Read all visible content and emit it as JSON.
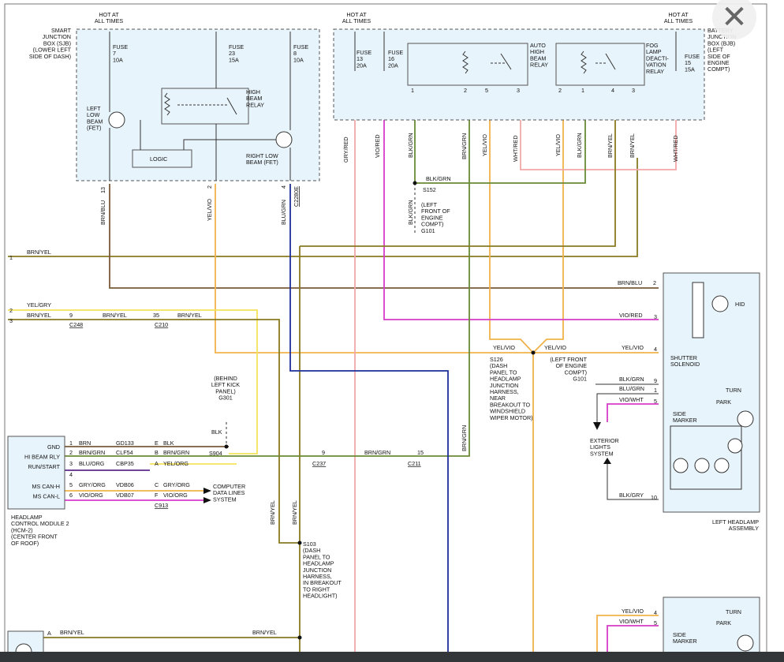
{
  "labels": {
    "hot_sjb": [
      "HOT AT",
      "ALL TIMES"
    ],
    "hot_center": [
      "HOT AT",
      "ALL TIMES"
    ],
    "hot_right": [
      "HOT AT",
      "ALL TIMES"
    ],
    "sjb": [
      "SMART",
      "JUNCTION",
      "BOX (SJB)",
      "(LOWER LEFT",
      "SIDE OF DASH)"
    ],
    "bjb": [
      "BATTERY",
      "JUNCTION",
      "BOX (BJB)",
      "(LEFT",
      "SIDE OF",
      "ENGINE",
      "COMPT)"
    ],
    "fuse7": [
      "FUSE",
      "7",
      "10A"
    ],
    "fuse23": [
      "FUSE",
      "23",
      "15A"
    ],
    "fuse8": [
      "FUSE",
      "8",
      "10A"
    ],
    "fuse13": [
      "FUSE",
      "13",
      "20A"
    ],
    "fuse16": [
      "FUSE",
      "16",
      "20A"
    ],
    "fuse15": [
      "FUSE",
      "15",
      "15A"
    ],
    "hbr": [
      "HIGH",
      "BEAM",
      "RELAY"
    ],
    "llb": [
      "LEFT",
      "LOW",
      "BEAM",
      "(FET)"
    ],
    "rlb": [
      "RIGHT LOW",
      "BEAM (FET)"
    ],
    "logic": "LOGIC",
    "auto_relay": [
      "AUTO",
      "HIGH",
      "BEAM",
      "RELAY"
    ],
    "fog_relay": [
      "FOG",
      "LAMP",
      "DEACTI-",
      "VATION",
      "RELAY"
    ],
    "s152": "S152",
    "blkgrn_top": "BLK/GRN",
    "g101_top": [
      "(LEFT",
      "FRONT OF",
      "ENGINE",
      "COMPT)",
      "G101"
    ],
    "s126": [
      "S126",
      "(DASH",
      "PANEL TO",
      "HEADLAMP",
      "JUNCTION",
      "HARNESS,",
      "NEAR",
      "BREAKOUT TO",
      "WINDSHIELD",
      "WIPER MOTOR)"
    ],
    "s103": [
      "S103",
      "(DASH",
      "PANEL TO",
      "HEADLAMP",
      "JUNCTION",
      "HARNESS,",
      "IN BREAKOUT",
      "TO RIGHT",
      "HEADLIGHT)"
    ],
    "g301": [
      "(BEHIND",
      "LEFT KICK",
      "PANEL)",
      "G301"
    ],
    "g101_mid": [
      "(LEFT FRONT",
      "OF ENGINE",
      "COMPT)",
      "G101"
    ],
    "s904": "S904",
    "hcm": [
      "HEADLAMP",
      "CONTROL MODULE 2",
      "(HCM-2)",
      "(CENTER FRONT",
      "OF ROOF)"
    ],
    "hcm_pins": [
      "GND",
      "HI BEAM RLY",
      "RUN/START",
      "",
      "MS CAN-H",
      "MS CAN-L"
    ],
    "computer": [
      "COMPUTER",
      "DATA LINES",
      "SYSTEM"
    ],
    "ext": [
      "EXTERIOR",
      "LIGHTS",
      "SYSTEM"
    ],
    "lha": [
      "LEFT HEADLAMP",
      "ASSEMBLY"
    ],
    "hid": "HID",
    "shutter": [
      "SHUTTER",
      "SOLENOID"
    ],
    "turn": "TURN",
    "park": "PARK",
    "side": [
      "SIDE",
      "MARKER"
    ],
    "c248": "C248",
    "c210": "C210",
    "c237": "C237",
    "c211": "C211",
    "c913": "C913",
    "c2280e": "C2280E"
  },
  "wires": {
    "brnblu": "BRN/BLU",
    "yelvio": "YEL/VIO",
    "blugrn": "BLU/GRN",
    "gryred": "GRY/RED",
    "viored": "VIO/RED",
    "blkgrn": "BLK/GRN",
    "brngrn": "BRN/GRN",
    "whtred": "WHT/RED",
    "brnyel": "BRN/YEL",
    "yelgry": "YEL/GRY",
    "blk": "BLK",
    "viowht": "VIO/WHT",
    "blkgry": "BLK/GRY",
    "gryorg": "GRY/ORG",
    "vioorg": "VIO/ORG",
    "bluorg": "BLU/ORG",
    "yelorg": "YEL/ORG",
    "brn": "BRN",
    "gd133": "GD133",
    "clf54": "CLF54",
    "cbp35": "CBP35",
    "vdb06": "VDB06",
    "vdb07": "VDB07"
  },
  "pins": {
    "p1": "1",
    "p2": "2",
    "p3": "3",
    "p4": "4",
    "p5": "5",
    "p6": "6",
    "p9": "9",
    "p10": "10",
    "p13": "13",
    "p15": "15",
    "p35": "35",
    "pa": "A",
    "pb": "B",
    "pc": "C",
    "pe": "E",
    "pf": "F"
  },
  "colors": {
    "olive": "#8a7a20",
    "brown": "#7a5a3a",
    "orange": "#f0b24a",
    "yellow": "#f3e35a",
    "pink": "#e27a9a",
    "magenta": "#d63cc8",
    "green": "#6a8a36",
    "blue": "#1a2ea8",
    "darkblue": "#1d2f9a",
    "lightpink": "#f2a7a7",
    "purple": "#5b2a8c",
    "box_fill": "#e8f4fb"
  },
  "icons": {
    "close": "close-icon"
  }
}
